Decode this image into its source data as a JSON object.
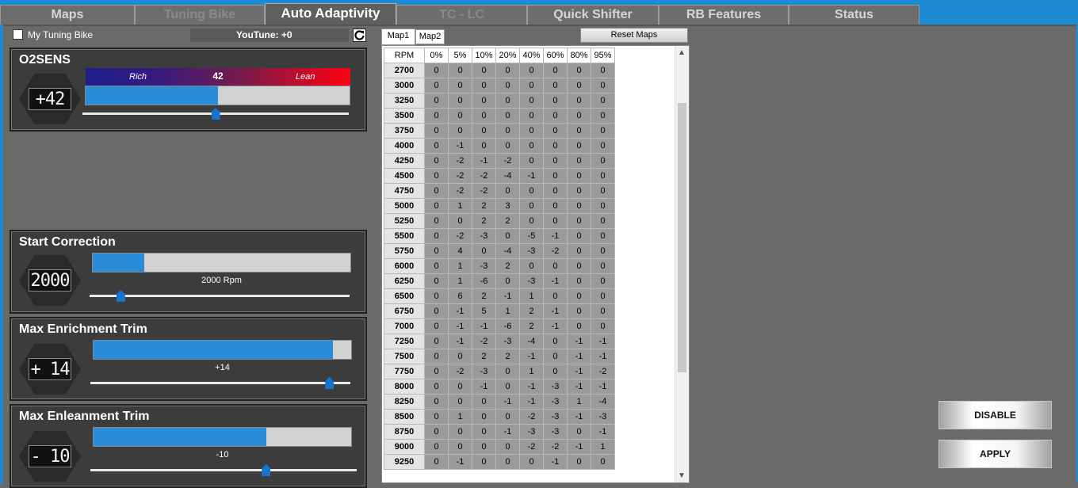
{
  "tabs": [
    {
      "label": "Maps",
      "state": "normal"
    },
    {
      "label": "Tuning Bike",
      "state": "disabled"
    },
    {
      "label": "Auto Adaptivity",
      "state": "active"
    },
    {
      "label": "TC - LC",
      "state": "disabled"
    },
    {
      "label": "Quick Shifter",
      "state": "normal"
    },
    {
      "label": "RB Features",
      "state": "normal"
    },
    {
      "label": "Status",
      "state": "normal"
    }
  ],
  "top": {
    "checkbox_label": "My Tuning Bike",
    "youtune": "YouTune: +0"
  },
  "o2sens": {
    "title": "O2SENS",
    "display": "+42",
    "rich": "Rich",
    "lean": "Lean",
    "value": "42",
    "bar_fraction": 0.5,
    "slider_fraction": 0.5
  },
  "start_correction": {
    "title": "Start Correction",
    "display": "2000",
    "value_label": "2000 Rpm",
    "bar_fraction": 0.2,
    "slider_fraction": 0.12
  },
  "max_enrichment": {
    "title": "Max Enrichment Trim",
    "display": "+ 14",
    "value_label": "+14",
    "bar_fraction": 0.93,
    "slider_fraction": 0.92
  },
  "max_enleanment": {
    "title": "Max Enleanment Trim",
    "display": "- 10",
    "value_label": "-10",
    "bar_fraction": 0.67,
    "slider_fraction": 0.66
  },
  "map_tabs": [
    "Map1",
    "Map2"
  ],
  "reset_label": "Reset Maps",
  "grid": {
    "rpm_header": "RPM",
    "columns": [
      "0%",
      "5%",
      "10%",
      "20%",
      "40%",
      "60%",
      "80%",
      "95%"
    ],
    "rows": [
      {
        "rpm": "2700",
        "vals": [
          "0",
          "0",
          "0",
          "0",
          "0",
          "0",
          "0",
          "0"
        ]
      },
      {
        "rpm": "3000",
        "vals": [
          "0",
          "0",
          "0",
          "0",
          "0",
          "0",
          "0",
          "0"
        ]
      },
      {
        "rpm": "3250",
        "vals": [
          "0",
          "0",
          "0",
          "0",
          "0",
          "0",
          "0",
          "0"
        ]
      },
      {
        "rpm": "3500",
        "vals": [
          "0",
          "0",
          "0",
          "0",
          "0",
          "0",
          "0",
          "0"
        ]
      },
      {
        "rpm": "3750",
        "vals": [
          "0",
          "0",
          "0",
          "0",
          "0",
          "0",
          "0",
          "0"
        ]
      },
      {
        "rpm": "4000",
        "vals": [
          "0",
          "-1",
          "0",
          "0",
          "0",
          "0",
          "0",
          "0"
        ]
      },
      {
        "rpm": "4250",
        "vals": [
          "0",
          "-2",
          "-1",
          "-2",
          "0",
          "0",
          "0",
          "0"
        ]
      },
      {
        "rpm": "4500",
        "vals": [
          "0",
          "-2",
          "-2",
          "-4",
          "-1",
          "0",
          "0",
          "0"
        ]
      },
      {
        "rpm": "4750",
        "vals": [
          "0",
          "-2",
          "-2",
          "0",
          "0",
          "0",
          "0",
          "0"
        ]
      },
      {
        "rpm": "5000",
        "vals": [
          "0",
          "1",
          "2",
          "3",
          "0",
          "0",
          "0",
          "0"
        ]
      },
      {
        "rpm": "5250",
        "vals": [
          "0",
          "0",
          "2",
          "2",
          "0",
          "0",
          "0",
          "0"
        ]
      },
      {
        "rpm": "5500",
        "vals": [
          "0",
          "-2",
          "-3",
          "0",
          "-5",
          "-1",
          "0",
          "0"
        ]
      },
      {
        "rpm": "5750",
        "vals": [
          "0",
          "4",
          "0",
          "-4",
          "-3",
          "-2",
          "0",
          "0"
        ]
      },
      {
        "rpm": "6000",
        "vals": [
          "0",
          "1",
          "-3",
          "2",
          "0",
          "0",
          "0",
          "0"
        ]
      },
      {
        "rpm": "6250",
        "vals": [
          "0",
          "1",
          "-6",
          "0",
          "-3",
          "-1",
          "0",
          "0"
        ]
      },
      {
        "rpm": "6500",
        "vals": [
          "0",
          "6",
          "2",
          "-1",
          "1",
          "0",
          "0",
          "0"
        ]
      },
      {
        "rpm": "6750",
        "vals": [
          "0",
          "-1",
          "5",
          "1",
          "2",
          "-1",
          "0",
          "0"
        ]
      },
      {
        "rpm": "7000",
        "vals": [
          "0",
          "-1",
          "-1",
          "-6",
          "2",
          "-1",
          "0",
          "0"
        ]
      },
      {
        "rpm": "7250",
        "vals": [
          "0",
          "-1",
          "-2",
          "-3",
          "-4",
          "0",
          "-1",
          "-1"
        ]
      },
      {
        "rpm": "7500",
        "vals": [
          "0",
          "0",
          "2",
          "2",
          "-1",
          "0",
          "-1",
          "-1"
        ]
      },
      {
        "rpm": "7750",
        "vals": [
          "0",
          "-2",
          "-3",
          "0",
          "1",
          "0",
          "-1",
          "-2"
        ]
      },
      {
        "rpm": "8000",
        "vals": [
          "0",
          "0",
          "-1",
          "0",
          "-1",
          "-3",
          "-1",
          "-1"
        ]
      },
      {
        "rpm": "8250",
        "vals": [
          "0",
          "0",
          "0",
          "-1",
          "-1",
          "-3",
          "1",
          "-4"
        ]
      },
      {
        "rpm": "8500",
        "vals": [
          "0",
          "1",
          "0",
          "0",
          "-2",
          "-3",
          "-1",
          "-3"
        ]
      },
      {
        "rpm": "8750",
        "vals": [
          "0",
          "0",
          "0",
          "-1",
          "-3",
          "-3",
          "0",
          "-1"
        ]
      },
      {
        "rpm": "9000",
        "vals": [
          "0",
          "0",
          "0",
          "0",
          "-2",
          "-2",
          "-1",
          "1"
        ]
      },
      {
        "rpm": "9250",
        "vals": [
          "0",
          "-1",
          "0",
          "0",
          "0",
          "-1",
          "0",
          "0"
        ]
      }
    ]
  },
  "buttons": {
    "disable": "DISABLE",
    "apply": "APPLY"
  },
  "colors": {
    "accent": "#1e8ad2",
    "bar": "#2a8cd6",
    "thumb": "#1674d0"
  }
}
